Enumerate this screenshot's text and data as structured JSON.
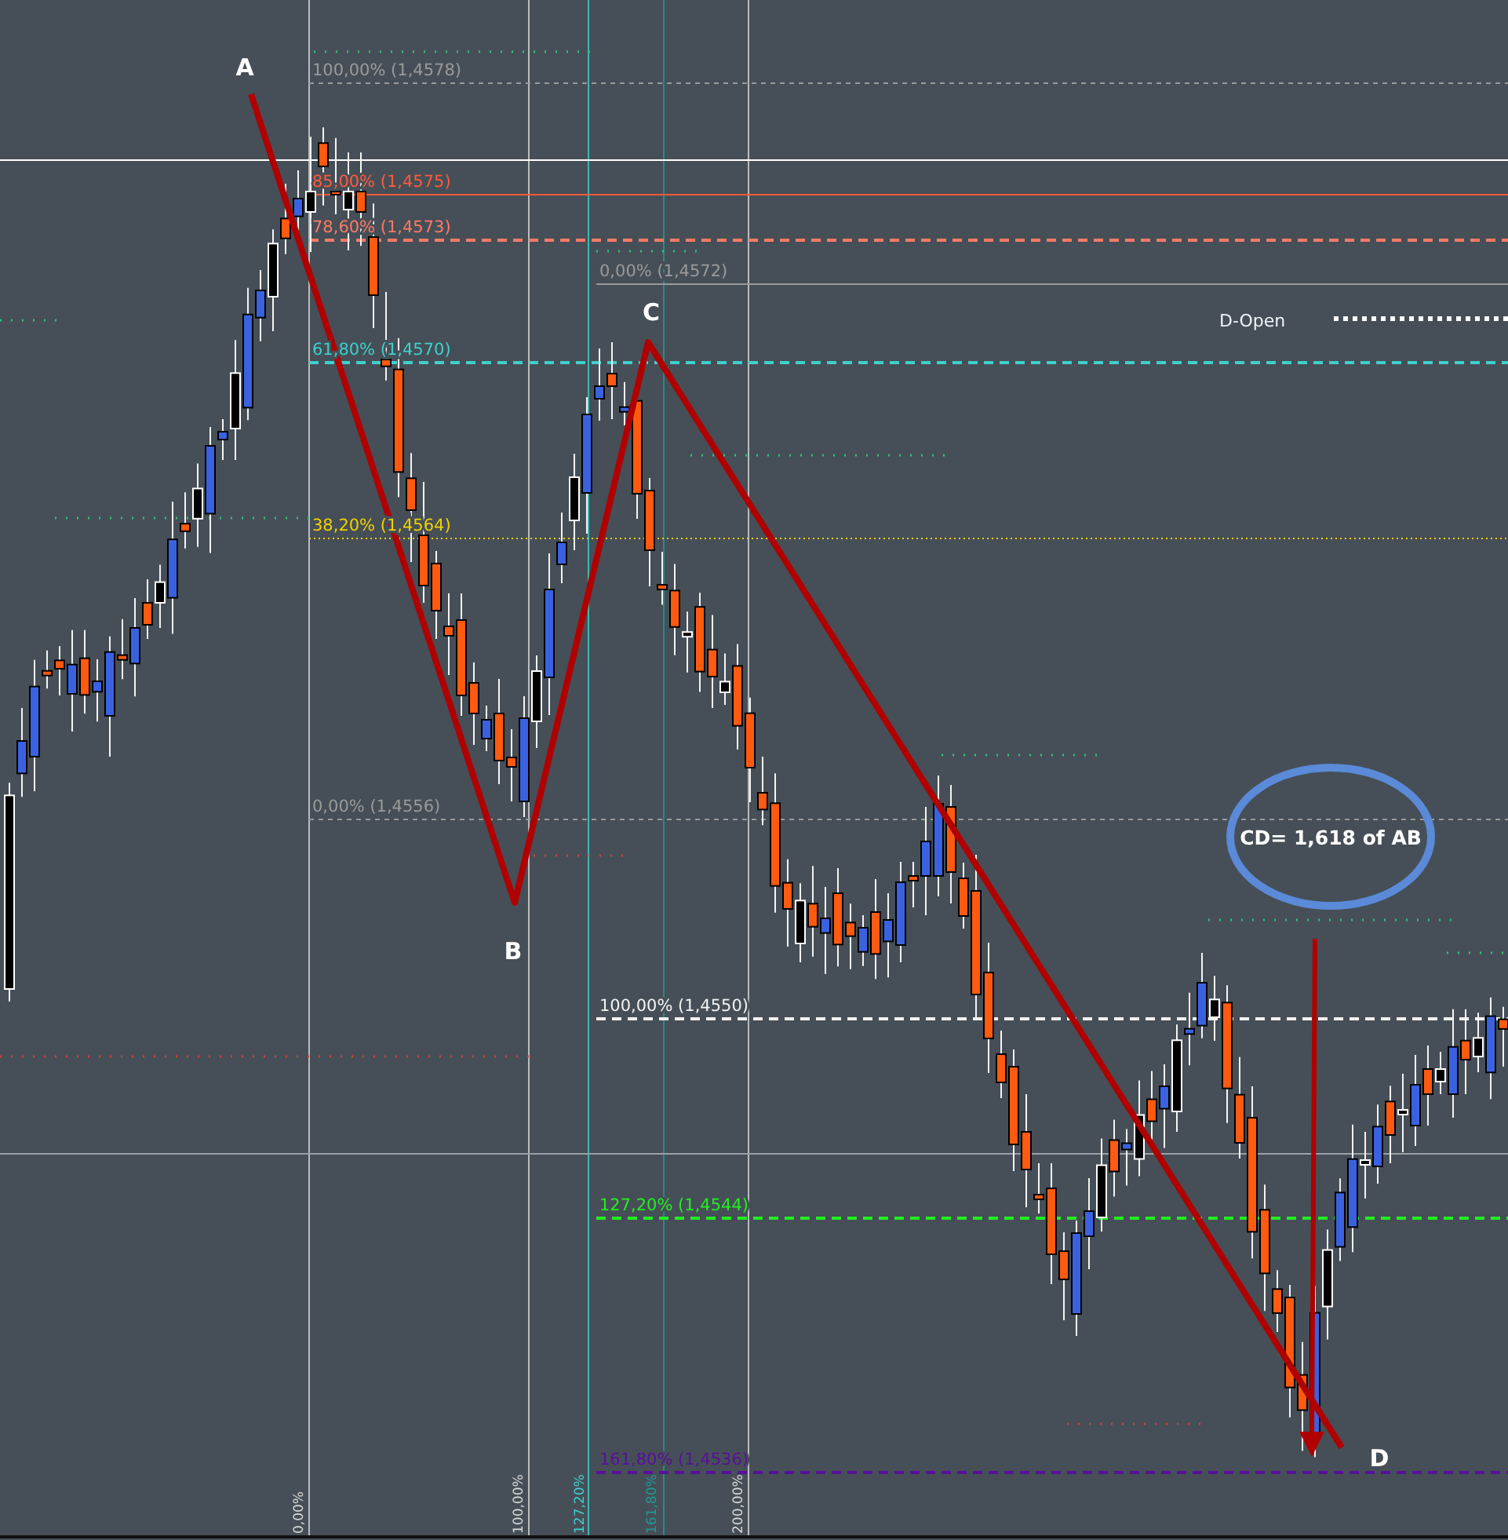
{
  "points": [
    {
      "label": "A"
    },
    {
      "label": "B"
    },
    {
      "label": "C"
    },
    {
      "label": "D"
    }
  ],
  "levels": [
    {
      "label": "100,00% (1,4578)",
      "color": "#9a9a9a"
    },
    {
      "label": "85,00% (1,4575)",
      "color": "#ff5a3c"
    },
    {
      "label": "78,60% (1,4573)",
      "color": "#ff7a66"
    },
    {
      "label": "0,00% (1,4572)",
      "color": "#9a9a9a"
    },
    {
      "label": "61,80% (1,4570)",
      "color": "#3ed0cc"
    },
    {
      "label": "38,20% (1,4564)",
      "color": "#f0d000"
    },
    {
      "label": "0,00% (1,4556)",
      "color": "#9a9a9a"
    },
    {
      "label": "100,00% (1,4550)",
      "color": "#f2f2f2"
    },
    {
      "label": "127,20% (1,4544)",
      "color": "#22ee22"
    },
    {
      "label": "161,80% (1,4536)",
      "color": "#5a0f9a"
    }
  ],
  "time_levels": [
    {
      "label": "0,00%",
      "color": "#d8d8d8"
    },
    {
      "label": "100,00%",
      "color": "#d8d8d8"
    },
    {
      "label": "127,20%",
      "color": "#3ed0cc"
    },
    {
      "label": "161,80%",
      "color": "#1f9a9a"
    },
    {
      "label": "200,00%",
      "color": "#d8d8d8"
    }
  ],
  "d_open": {
    "label": "D-Open"
  },
  "callout": {
    "text": "CD= 1,618 of AB"
  }
}
